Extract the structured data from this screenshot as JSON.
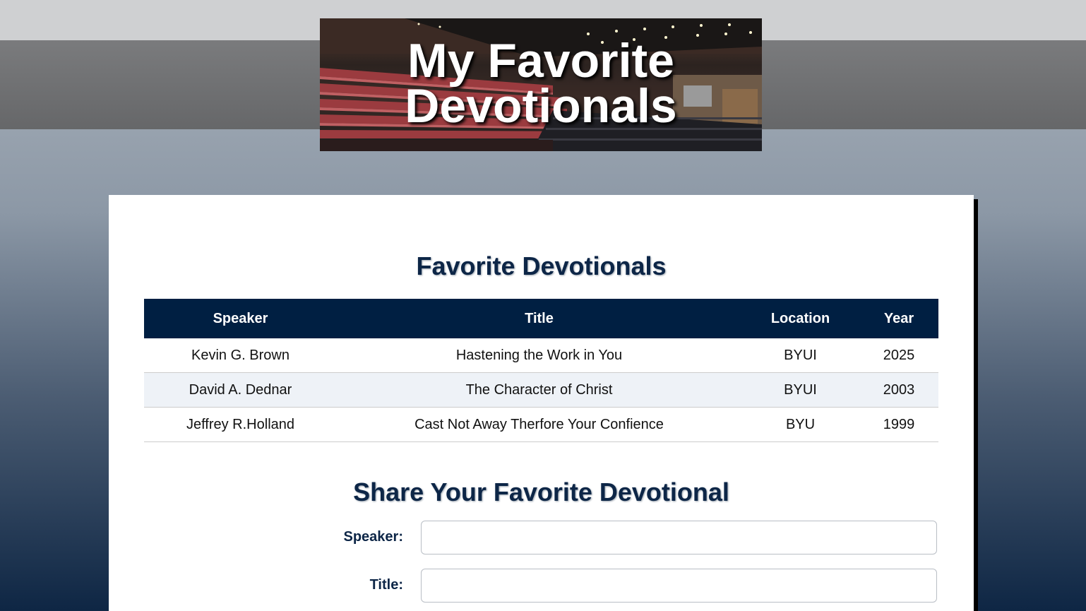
{
  "header": {
    "banner_title_line1": "My Favorite",
    "banner_title_line2": "Devotionals"
  },
  "favorites": {
    "heading": "Favorite Devotionals",
    "columns": [
      "Speaker",
      "Title",
      "Location",
      "Year"
    ],
    "rows": [
      {
        "speaker": "Kevin G. Brown",
        "title": "Hastening the Work in You",
        "location": "BYUI",
        "year": "2025"
      },
      {
        "speaker": "David A. Dednar",
        "title": "The Character of Christ",
        "location": "BYUI",
        "year": "2003"
      },
      {
        "speaker": "Jeffrey R.Holland",
        "title": "Cast Not Away Therfore Your Confience",
        "location": "BYU",
        "year": "1999"
      }
    ]
  },
  "share_form": {
    "heading": "Share Your Favorite Devotional",
    "speaker_label": "Speaker:",
    "speaker_value": "",
    "title_label": "Title:",
    "title_value": ""
  },
  "colors": {
    "header_navy": "#001f42",
    "heading_text": "#0d2647",
    "alt_row": "#eef2f7"
  }
}
